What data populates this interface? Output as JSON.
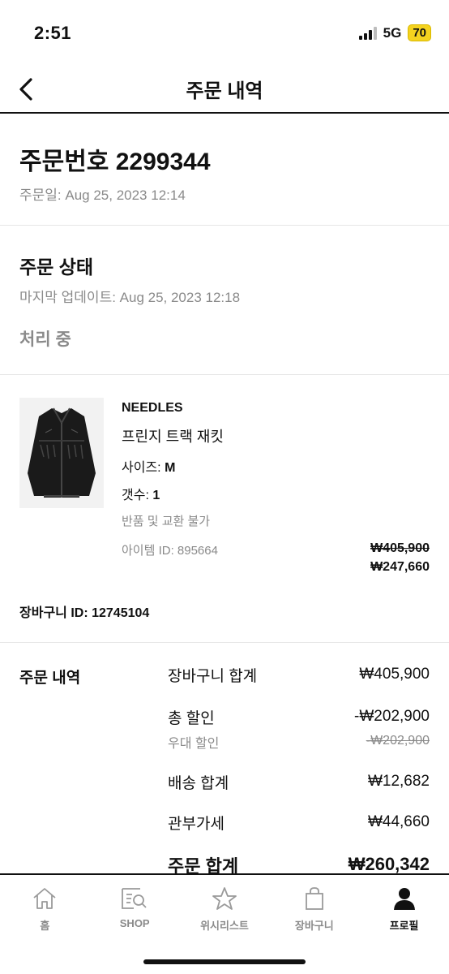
{
  "status_bar": {
    "time": "2:51",
    "network": "5G",
    "battery": "70"
  },
  "header": {
    "title": "주문 내역"
  },
  "order": {
    "number": "주문번호 2299344",
    "date": "주문일: Aug 25, 2023 12:14"
  },
  "status": {
    "title": "주문 상태",
    "updated": "마지막 업데이트: Aug 25, 2023 12:18",
    "value": "처리 중"
  },
  "item": {
    "brand": "NEEDLES",
    "name": "프린지 트랙 재킷",
    "size_label": "사이즈: ",
    "size_value": "M",
    "qty_label": "갯수: ",
    "qty_value": "1",
    "return_note": "반품 및 교환 불가",
    "item_id": "아이템 ID: 895664",
    "price_original": "₩405,900",
    "price_sale": "₩247,660"
  },
  "cart_id": "장바구니 ID: 12745104",
  "summary": {
    "heading": "주문 내역",
    "cart_total_label": "장바구니 합계",
    "cart_total_value": "₩405,900",
    "discount_label": "총 할인",
    "discount_value": "-₩202,900",
    "vip_discount_label": "우대 할인",
    "vip_discount_value": "-₩202,900",
    "shipping_label": "배송 합계",
    "shipping_value": "₩12,682",
    "tax_label": "관부가세",
    "tax_value": "₩44,660",
    "order_total_label": "주문 합계",
    "order_total_value": "₩260,342"
  },
  "nav": {
    "home": "홈",
    "shop": "SHOP",
    "wishlist": "위시리스트",
    "cart": "장바구니",
    "profile": "프로필"
  },
  "colors": {
    "battery": "#f4d21f",
    "muted": "#8a8a8a",
    "text": "#111111"
  },
  "icons": [
    "back-arrow-icon",
    "home-icon",
    "shop-search-icon",
    "star-icon",
    "shopping-bag-icon",
    "profile-icon"
  ]
}
